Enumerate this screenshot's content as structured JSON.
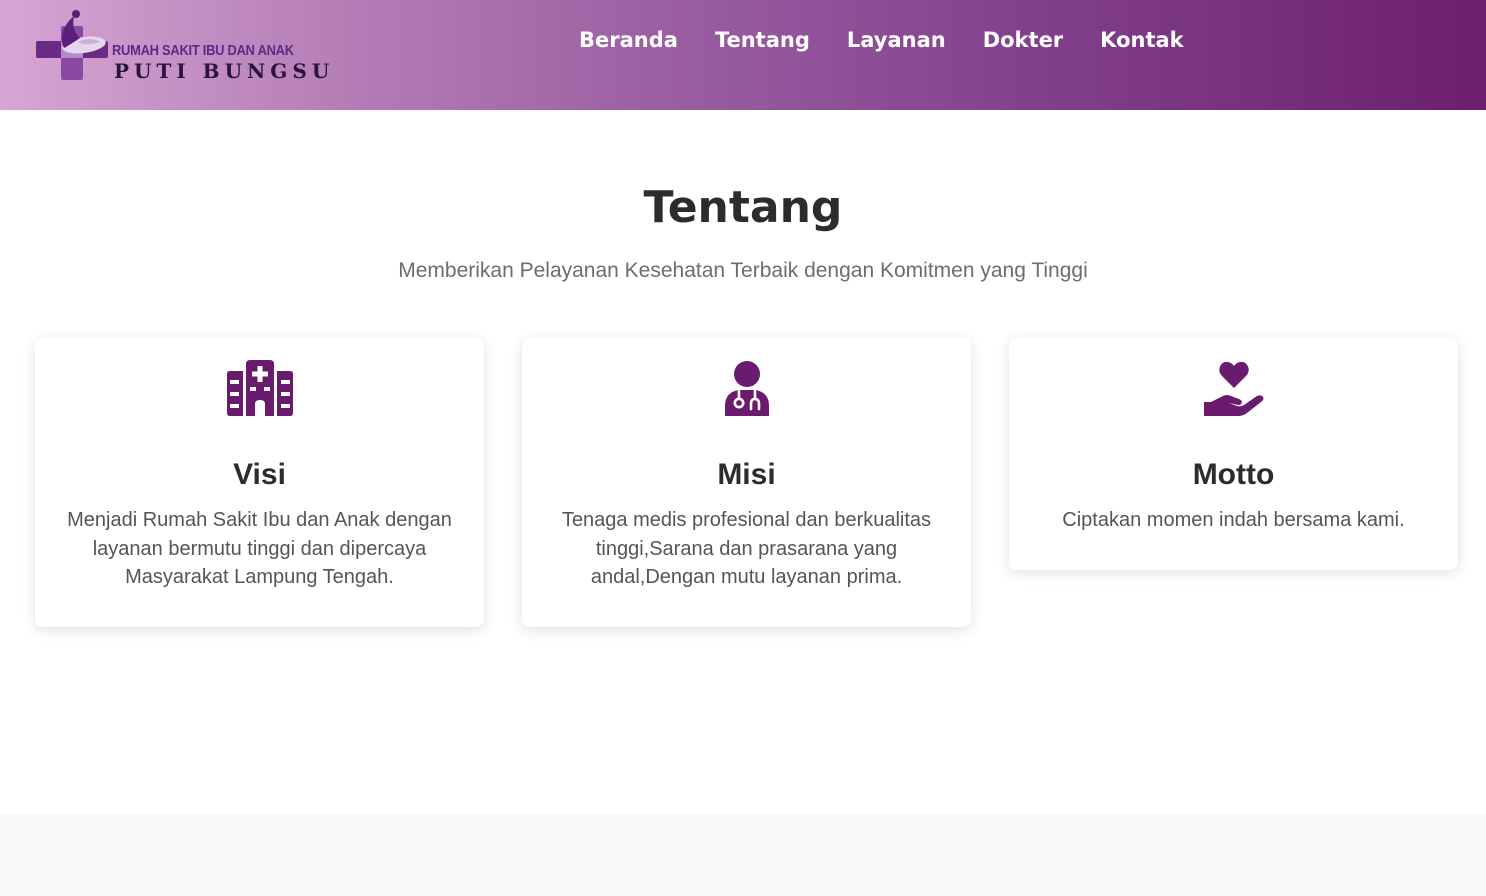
{
  "logo": {
    "line1": "RUMAH SAKIT IBU DAN ANAK",
    "line2": "PUTI BUNGSU",
    "icon": "mother-child-cross-logo"
  },
  "nav": {
    "items": [
      {
        "label": "Beranda"
      },
      {
        "label": "Tentang"
      },
      {
        "label": "Layanan"
      },
      {
        "label": "Dokter"
      },
      {
        "label": "Kontak"
      }
    ]
  },
  "about": {
    "title": "Tentang",
    "subtitle": "Memberikan Pelayanan Kesehatan Terbaik dengan Komitmen yang Tinggi",
    "cards": [
      {
        "icon": "hospital-icon",
        "title": "Visi",
        "text": "Menjadi Rumah Sakit Ibu dan Anak dengan layanan bermutu tinggi dan dipercaya Masyarakat Lampung Tengah."
      },
      {
        "icon": "doctor-icon",
        "title": "Misi",
        "text": "Tenaga medis profesional dan berkualitas tinggi,Sarana dan prasarana yang andal,Dengan mutu layanan prima."
      },
      {
        "icon": "hand-holding-heart-icon",
        "title": "Motto",
        "text": "Ciptakan momen indah bersama kami."
      }
    ]
  },
  "colors": {
    "brand_purple": "#6a1b6e",
    "header_gradient_start": "#d7a6d4",
    "header_gradient_end": "#6c1f6d",
    "heading_text": "#2c2c2c",
    "body_text": "#555555"
  }
}
